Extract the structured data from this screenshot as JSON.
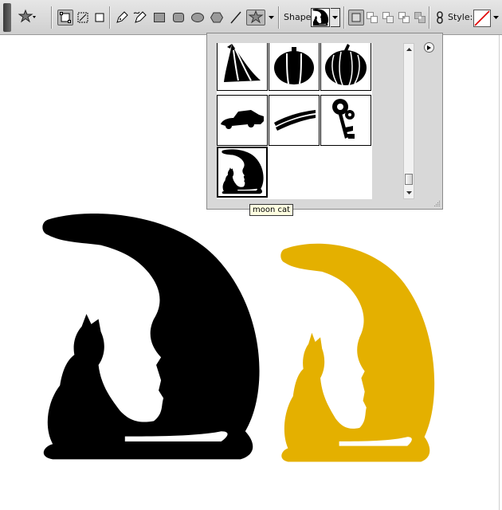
{
  "toolbar": {
    "shape_label": "Shape:",
    "style_label": "Style:",
    "tools": [
      "custom-shape-tool-preset",
      "shape-layers-mode",
      "paths-mode",
      "fill-pixels-mode",
      "pen-tool",
      "freeform-pen-tool",
      "rectangle-tool",
      "rounded-rectangle-tool",
      "ellipse-tool",
      "polygon-tool",
      "line-tool",
      "custom-shape-tool"
    ],
    "combine_modes": [
      "create-new",
      "add",
      "subtract",
      "intersect",
      "exclude"
    ],
    "active_tool": "custom-shape-tool"
  },
  "shape_picker": {
    "shapes": [
      "tent",
      "pumpkin",
      "pumpkin-2",
      "car",
      "stripes",
      "key",
      "moon-cat"
    ],
    "selected": "moon-cat",
    "tooltip": "moon cat"
  },
  "canvas": {
    "shapes": [
      {
        "name": "moon-cat-black",
        "color": "#000000"
      },
      {
        "name": "moon-cat-gold",
        "color": "#e4b000"
      }
    ]
  }
}
